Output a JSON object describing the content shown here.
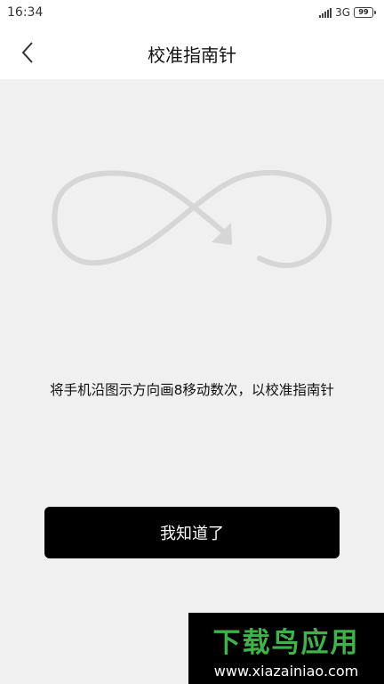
{
  "status_bar": {
    "time": "16:34",
    "network": "3G",
    "battery": "99"
  },
  "header": {
    "title": "校准指南针",
    "back_icon": "chevron-left-icon"
  },
  "main": {
    "figure_icon": "figure-eight-arrow-icon",
    "instruction": "将手机沿图示方向画8移动数次，以校准指南针",
    "confirm_label": "我知道了"
  },
  "watermark": {
    "title": "下载鸟应用",
    "url": "www.xiazainiao.com"
  },
  "colors": {
    "background": "#f0f0f0",
    "button": "#000000",
    "figure_stroke": "#d6d6d6",
    "watermark_green": "#3fb34a"
  }
}
